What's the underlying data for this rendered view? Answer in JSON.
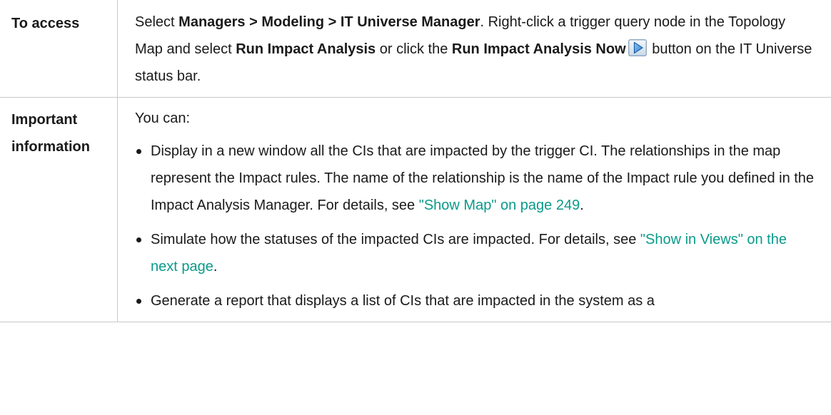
{
  "rows": {
    "access": {
      "label": "To access",
      "t1": "Select ",
      "path": "Managers > Modeling > IT Universe Manager",
      "t2": ". Right-click a trigger query node in the Topology Map and select ",
      "menu_item": "Run Impact Analysis",
      "t3": " or click the ",
      "button_name": "Run Impact Analysis Now",
      "t4": " button on the IT Universe status bar.",
      "button_icon": "run-impact-analysis-play-icon"
    },
    "important": {
      "label": "Important information",
      "intro": "You can:",
      "bullets": [
        {
          "text": "Display in a new window all the CIs that are impacted by the trigger CI. The relationships in the map represent the Impact rules. The name of the relationship is the name of the Impact rule you defined in the Impact Analysis Manager. For details, see ",
          "link": "\"Show Map\" on page 249",
          "tail": "."
        },
        {
          "text": "Simulate how the statuses of the impacted CIs are impacted. For details, see ",
          "link": "\"Show in Views\" on the next page",
          "tail": "."
        },
        {
          "text": "Generate a report that displays a list of CIs that are impacted in the system as a",
          "link": "",
          "tail": ""
        }
      ]
    }
  },
  "colors": {
    "link": "#0a9a8a",
    "border": "#c8c8c8",
    "text": "#1a1a1a"
  }
}
